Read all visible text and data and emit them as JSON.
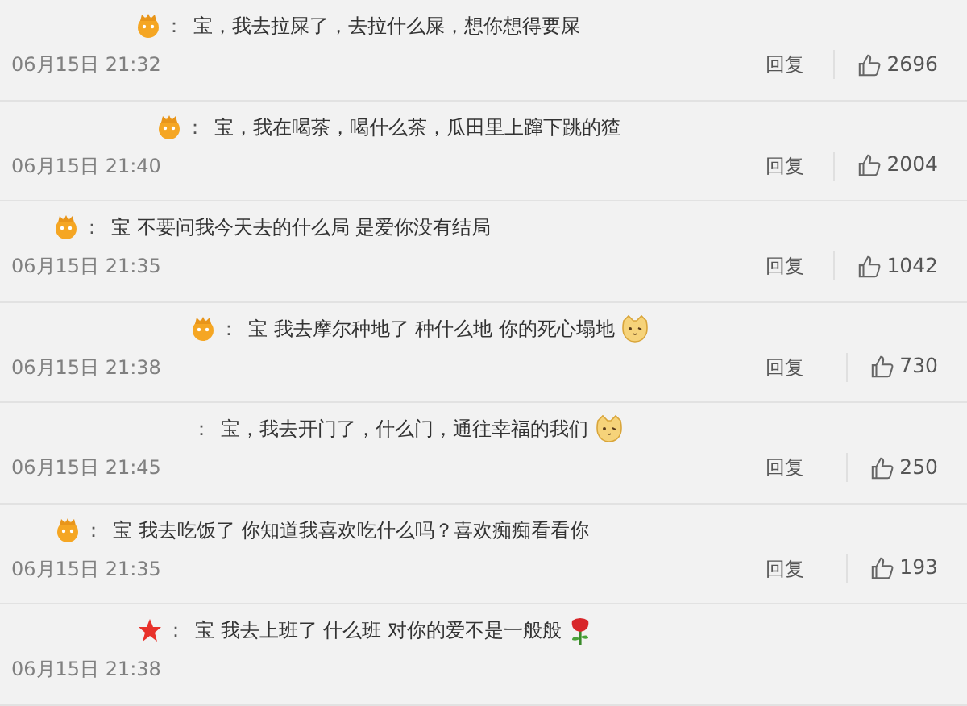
{
  "comments": [
    {
      "badge": {
        "kind": "crown"
      },
      "separator": "：",
      "text": "宝，我去拉屎了，去拉什么屎，想你想得要屎",
      "date": "06月15日 21:32",
      "reply": "回复",
      "likes": "2696"
    },
    {
      "badge": {
        "kind": "crown"
      },
      "separator": "：",
      "text": "宝，我在喝茶，喝什么茶，瓜田里上蹿下跳的猹",
      "date": "06月15日 21:40",
      "reply": "回复",
      "likes": "2004"
    },
    {
      "badge": {
        "kind": "crown"
      },
      "separator": "：",
      "text": "宝 不要问我今天去的什么局 是爱你没有结局",
      "date": "06月15日 21:35",
      "reply": "回复",
      "likes": "1042"
    },
    {
      "badge": {
        "kind": "crown"
      },
      "separator": "：",
      "text": "宝 我去摩尔种地了 种什么地 你的死心塌地",
      "emoji": {
        "kind": "cat"
      },
      "date": "06月15日 21:38",
      "reply": "回复",
      "likes": "730"
    },
    {
      "separator": "：",
      "text": "宝，我去开门了，什么门，通往幸福的我们",
      "emoji": {
        "kind": "cat"
      },
      "date": "06月15日 21:45",
      "reply": "回复",
      "likes": "250"
    },
    {
      "badge": {
        "kind": "crown"
      },
      "separator": "：",
      "text": "宝 我去吃饭了 你知道我喜欢吃什么吗？喜欢痴痴看看你",
      "date": "06月15日 21:35",
      "reply": "回复",
      "likes": "193"
    },
    {
      "badge": {
        "kind": "star"
      },
      "separator": "：",
      "text": "宝 我去上班了 什么班 对你的爱不是一般般",
      "emoji": {
        "kind": "rose"
      },
      "date": "06月15日 21:38"
    }
  ]
}
